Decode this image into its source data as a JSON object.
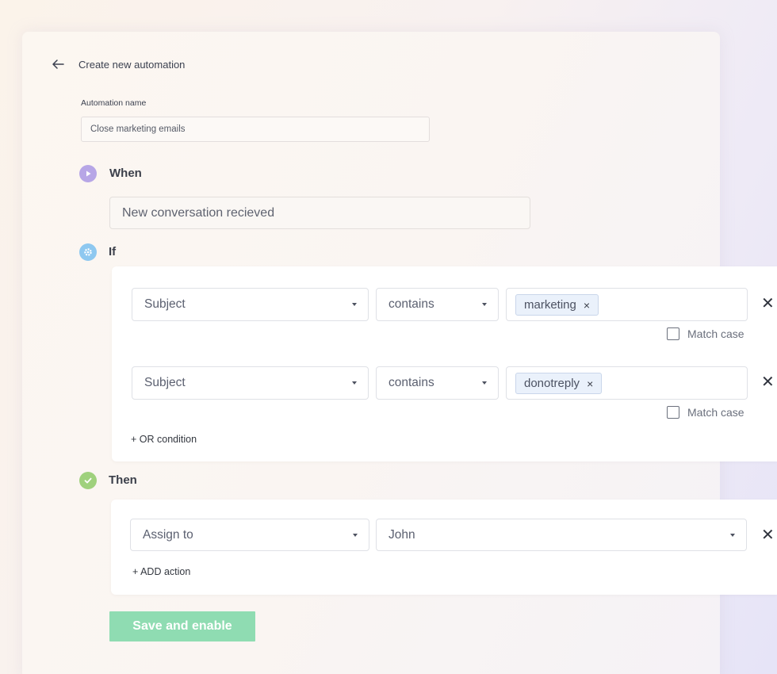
{
  "header": {
    "title": "Create new automation"
  },
  "automation_name": {
    "label": "Automation name",
    "value": "Close marketing emails"
  },
  "when": {
    "title": "When",
    "trigger": "New conversation recieved"
  },
  "if": {
    "title": "If",
    "conditions": [
      {
        "field": "Subject",
        "operator": "contains",
        "tag": "marketing",
        "match_case_label": "Match case"
      },
      {
        "field": "Subject",
        "operator": "contains",
        "tag": "donotreply",
        "match_case_label": "Match case"
      }
    ],
    "add_or_label": "+ OR condition"
  },
  "then": {
    "title": "Then",
    "actions": [
      {
        "action": "Assign to",
        "value": "John"
      }
    ],
    "add_action_label": "+ ADD action"
  },
  "save_button": "Save and enable",
  "icons": {
    "back": "arrow-left-icon",
    "when": "play-icon",
    "if": "gear-icon",
    "then": "check-icon",
    "tag_remove": "×",
    "remove": "✕"
  },
  "colors": {
    "when_icon": "#b7a6e6",
    "if_icon": "#8ec8f0",
    "then_icon": "#9fd17d",
    "save_button": "#8fdcb2",
    "tag_bg": "#eaf1fb"
  }
}
